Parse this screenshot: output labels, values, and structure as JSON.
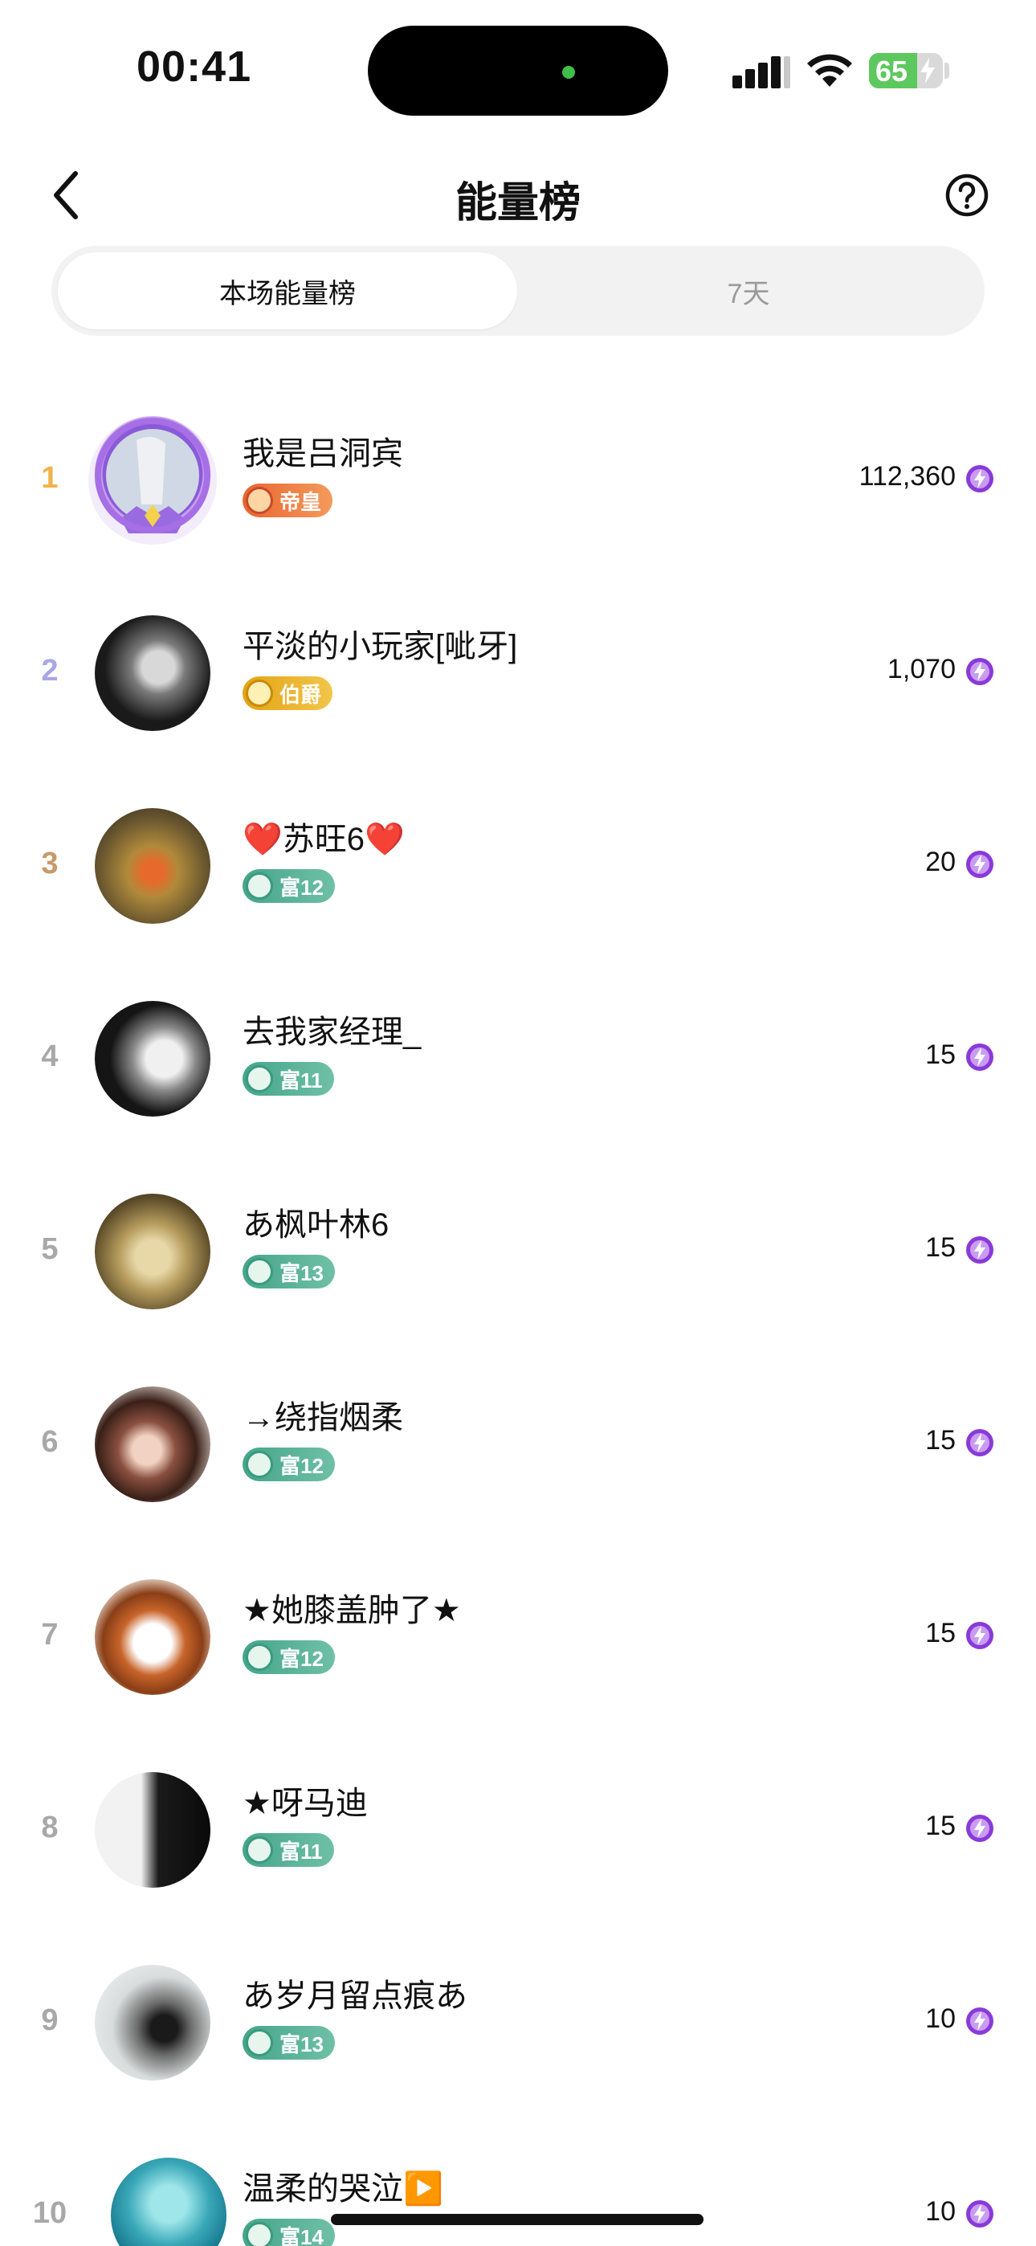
{
  "status_bar": {
    "time": "00:41",
    "battery_percent": "65",
    "battery_level": 0.65,
    "battery_color": "#5dc85d"
  },
  "nav": {
    "title": "能量榜",
    "back_icon": "chevron-left-icon",
    "help_icon": "question-circle-icon"
  },
  "tabs": [
    {
      "label": "本场能量榜",
      "active": true
    },
    {
      "label": "7天",
      "active": false
    }
  ],
  "ranking": [
    {
      "rank": "1",
      "name": "我是吕洞宾",
      "badge": "帝皇",
      "badge_type": "di",
      "score": "112,360"
    },
    {
      "rank": "2",
      "name": "平淡的小玩家[呲牙]",
      "badge": "伯爵",
      "badge_type": "bo",
      "score": "1,070"
    },
    {
      "rank": "3",
      "name": "❤️苏旺6❤️",
      "badge": "富12",
      "badge_type": "fu",
      "score": "20"
    },
    {
      "rank": "4",
      "name": "去我家经理_",
      "badge": "富11",
      "badge_type": "fu",
      "score": "15"
    },
    {
      "rank": "5",
      "name": "あ枫叶林6",
      "badge": "富13",
      "badge_type": "fu",
      "score": "15"
    },
    {
      "rank": "6",
      "name": "→绕指烟柔",
      "badge": "富12",
      "badge_type": "fu",
      "score": "15"
    },
    {
      "rank": "7",
      "name": "★她膝盖肿了★",
      "badge": "富12",
      "badge_type": "fu",
      "score": "15"
    },
    {
      "rank": "8",
      "name": "★呀马迪",
      "badge": "富11",
      "badge_type": "fu",
      "score": "15"
    },
    {
      "rank": "9",
      "name": "あ岁月留点痕あ",
      "badge": "富13",
      "badge_type": "fu",
      "score": "10"
    },
    {
      "rank": "10",
      "name": "温柔的哭泣▶️",
      "badge": "富14",
      "badge_type": "fu",
      "score": "10"
    }
  ],
  "colors": {
    "rank_gold": "#f0b24a",
    "rank_silver": "#a9a6e8",
    "rank_bronze": "#c79a6a",
    "energy_purple": "#8a3ad8"
  }
}
